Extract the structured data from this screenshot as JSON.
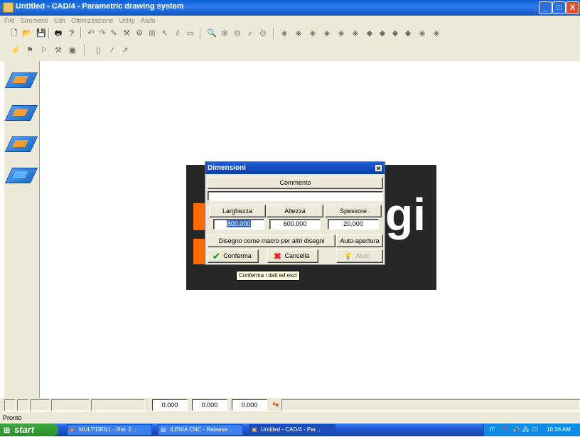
{
  "window": {
    "title": "Untitled - CAD/4 - Parametric drawing system",
    "buttons": {
      "minimize": "_",
      "maximize": "□",
      "close": "X"
    }
  },
  "menu": [
    "File",
    "Strumenti",
    "Edit",
    "Ottimizzazione",
    "Utility",
    "Aiuto"
  ],
  "dialog": {
    "title": "Dimensioni",
    "comment_button": "Commento",
    "comment_value": "",
    "width_button": "Larghezza",
    "height_button": "Altezza",
    "thickness_button": "Spessore",
    "width_value": "800.000",
    "height_value": "600.000",
    "thickness_value": "20.000",
    "macro_button": "Disegno come macro per altri disegni",
    "autoopen_button": "Auto-apertura",
    "confirm_button": "Conferma",
    "cancel_button": "Cancella",
    "help_button": "Aiuto"
  },
  "background_text": "gi",
  "tooltip": "Conferma i dati ed esci",
  "coords": [
    "0.000",
    "0.000",
    "0.000"
  ],
  "status": "Pronto",
  "taskbar": {
    "start": "start",
    "tasks": [
      "MULTIDRILL - Rel. 2...",
      "ILENIA CNC - Release...",
      "Untitled - CAD/4 - Par..."
    ],
    "tray_lang": "IT",
    "clock": "10:36 AM"
  },
  "colors": {
    "accent": "#ff6a00",
    "titlebar": "#0a5fd8",
    "dialog_bg": "#ece9d8"
  }
}
